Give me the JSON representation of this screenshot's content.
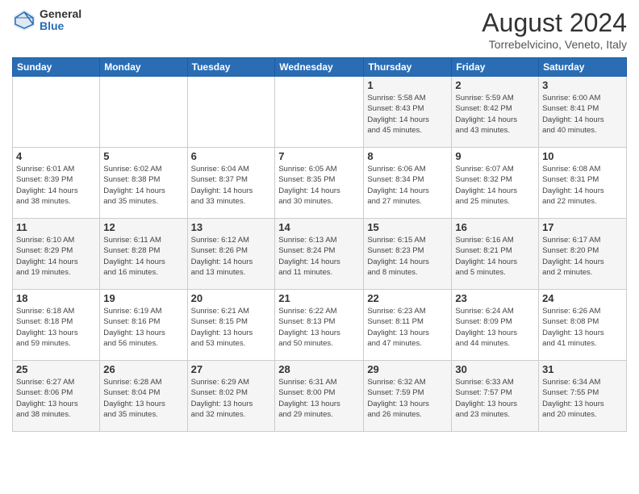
{
  "logo": {
    "general": "General",
    "blue": "Blue"
  },
  "title": "August 2024",
  "subtitle": "Torrebelvicino, Veneto, Italy",
  "days_of_week": [
    "Sunday",
    "Monday",
    "Tuesday",
    "Wednesday",
    "Thursday",
    "Friday",
    "Saturday"
  ],
  "weeks": [
    [
      {
        "day": "",
        "info": ""
      },
      {
        "day": "",
        "info": ""
      },
      {
        "day": "",
        "info": ""
      },
      {
        "day": "",
        "info": ""
      },
      {
        "day": "1",
        "info": "Sunrise: 5:58 AM\nSunset: 8:43 PM\nDaylight: 14 hours\nand 45 minutes."
      },
      {
        "day": "2",
        "info": "Sunrise: 5:59 AM\nSunset: 8:42 PM\nDaylight: 14 hours\nand 43 minutes."
      },
      {
        "day": "3",
        "info": "Sunrise: 6:00 AM\nSunset: 8:41 PM\nDaylight: 14 hours\nand 40 minutes."
      }
    ],
    [
      {
        "day": "4",
        "info": "Sunrise: 6:01 AM\nSunset: 8:39 PM\nDaylight: 14 hours\nand 38 minutes."
      },
      {
        "day": "5",
        "info": "Sunrise: 6:02 AM\nSunset: 8:38 PM\nDaylight: 14 hours\nand 35 minutes."
      },
      {
        "day": "6",
        "info": "Sunrise: 6:04 AM\nSunset: 8:37 PM\nDaylight: 14 hours\nand 33 minutes."
      },
      {
        "day": "7",
        "info": "Sunrise: 6:05 AM\nSunset: 8:35 PM\nDaylight: 14 hours\nand 30 minutes."
      },
      {
        "day": "8",
        "info": "Sunrise: 6:06 AM\nSunset: 8:34 PM\nDaylight: 14 hours\nand 27 minutes."
      },
      {
        "day": "9",
        "info": "Sunrise: 6:07 AM\nSunset: 8:32 PM\nDaylight: 14 hours\nand 25 minutes."
      },
      {
        "day": "10",
        "info": "Sunrise: 6:08 AM\nSunset: 8:31 PM\nDaylight: 14 hours\nand 22 minutes."
      }
    ],
    [
      {
        "day": "11",
        "info": "Sunrise: 6:10 AM\nSunset: 8:29 PM\nDaylight: 14 hours\nand 19 minutes."
      },
      {
        "day": "12",
        "info": "Sunrise: 6:11 AM\nSunset: 8:28 PM\nDaylight: 14 hours\nand 16 minutes."
      },
      {
        "day": "13",
        "info": "Sunrise: 6:12 AM\nSunset: 8:26 PM\nDaylight: 14 hours\nand 13 minutes."
      },
      {
        "day": "14",
        "info": "Sunrise: 6:13 AM\nSunset: 8:24 PM\nDaylight: 14 hours\nand 11 minutes."
      },
      {
        "day": "15",
        "info": "Sunrise: 6:15 AM\nSunset: 8:23 PM\nDaylight: 14 hours\nand 8 minutes."
      },
      {
        "day": "16",
        "info": "Sunrise: 6:16 AM\nSunset: 8:21 PM\nDaylight: 14 hours\nand 5 minutes."
      },
      {
        "day": "17",
        "info": "Sunrise: 6:17 AM\nSunset: 8:20 PM\nDaylight: 14 hours\nand 2 minutes."
      }
    ],
    [
      {
        "day": "18",
        "info": "Sunrise: 6:18 AM\nSunset: 8:18 PM\nDaylight: 13 hours\nand 59 minutes."
      },
      {
        "day": "19",
        "info": "Sunrise: 6:19 AM\nSunset: 8:16 PM\nDaylight: 13 hours\nand 56 minutes."
      },
      {
        "day": "20",
        "info": "Sunrise: 6:21 AM\nSunset: 8:15 PM\nDaylight: 13 hours\nand 53 minutes."
      },
      {
        "day": "21",
        "info": "Sunrise: 6:22 AM\nSunset: 8:13 PM\nDaylight: 13 hours\nand 50 minutes."
      },
      {
        "day": "22",
        "info": "Sunrise: 6:23 AM\nSunset: 8:11 PM\nDaylight: 13 hours\nand 47 minutes."
      },
      {
        "day": "23",
        "info": "Sunrise: 6:24 AM\nSunset: 8:09 PM\nDaylight: 13 hours\nand 44 minutes."
      },
      {
        "day": "24",
        "info": "Sunrise: 6:26 AM\nSunset: 8:08 PM\nDaylight: 13 hours\nand 41 minutes."
      }
    ],
    [
      {
        "day": "25",
        "info": "Sunrise: 6:27 AM\nSunset: 8:06 PM\nDaylight: 13 hours\nand 38 minutes."
      },
      {
        "day": "26",
        "info": "Sunrise: 6:28 AM\nSunset: 8:04 PM\nDaylight: 13 hours\nand 35 minutes."
      },
      {
        "day": "27",
        "info": "Sunrise: 6:29 AM\nSunset: 8:02 PM\nDaylight: 13 hours\nand 32 minutes."
      },
      {
        "day": "28",
        "info": "Sunrise: 6:31 AM\nSunset: 8:00 PM\nDaylight: 13 hours\nand 29 minutes."
      },
      {
        "day": "29",
        "info": "Sunrise: 6:32 AM\nSunset: 7:59 PM\nDaylight: 13 hours\nand 26 minutes."
      },
      {
        "day": "30",
        "info": "Sunrise: 6:33 AM\nSunset: 7:57 PM\nDaylight: 13 hours\nand 23 minutes."
      },
      {
        "day": "31",
        "info": "Sunrise: 6:34 AM\nSunset: 7:55 PM\nDaylight: 13 hours\nand 20 minutes."
      }
    ]
  ]
}
